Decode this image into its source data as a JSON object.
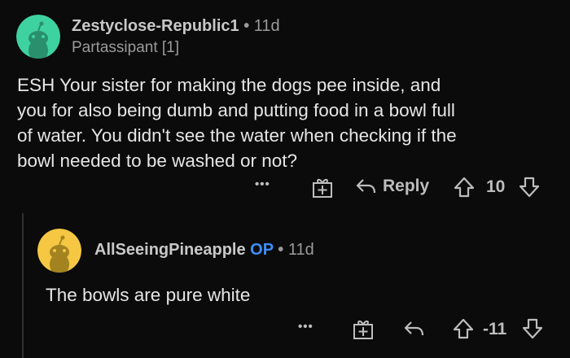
{
  "comment": {
    "username": "Zestyclose-Republic1",
    "separator": "•",
    "age": "11d",
    "flair": "Partassipant [1]",
    "avatar_color": "#3fd2a1",
    "body_lines": [
      "ESH Your sister for making the dogs pee inside, and",
      "you for also being dumb and putting food in a bowl full",
      "of water. You didn't see the water when checking if the",
      "bowl needed to be washed or not?"
    ],
    "actions": {
      "more": "•••",
      "reply_label": "Reply",
      "score": "10"
    }
  },
  "reply": {
    "username": "AllSeeingPineapple",
    "op_badge": "OP",
    "separator": "•",
    "age": "11d",
    "avatar_color": "#f5c742",
    "body": "The bowls are pure white",
    "actions": {
      "more": "•••",
      "score": "-11"
    }
  },
  "colors": {
    "background": "#0b0b0b",
    "op_blue": "#3d8eff"
  }
}
